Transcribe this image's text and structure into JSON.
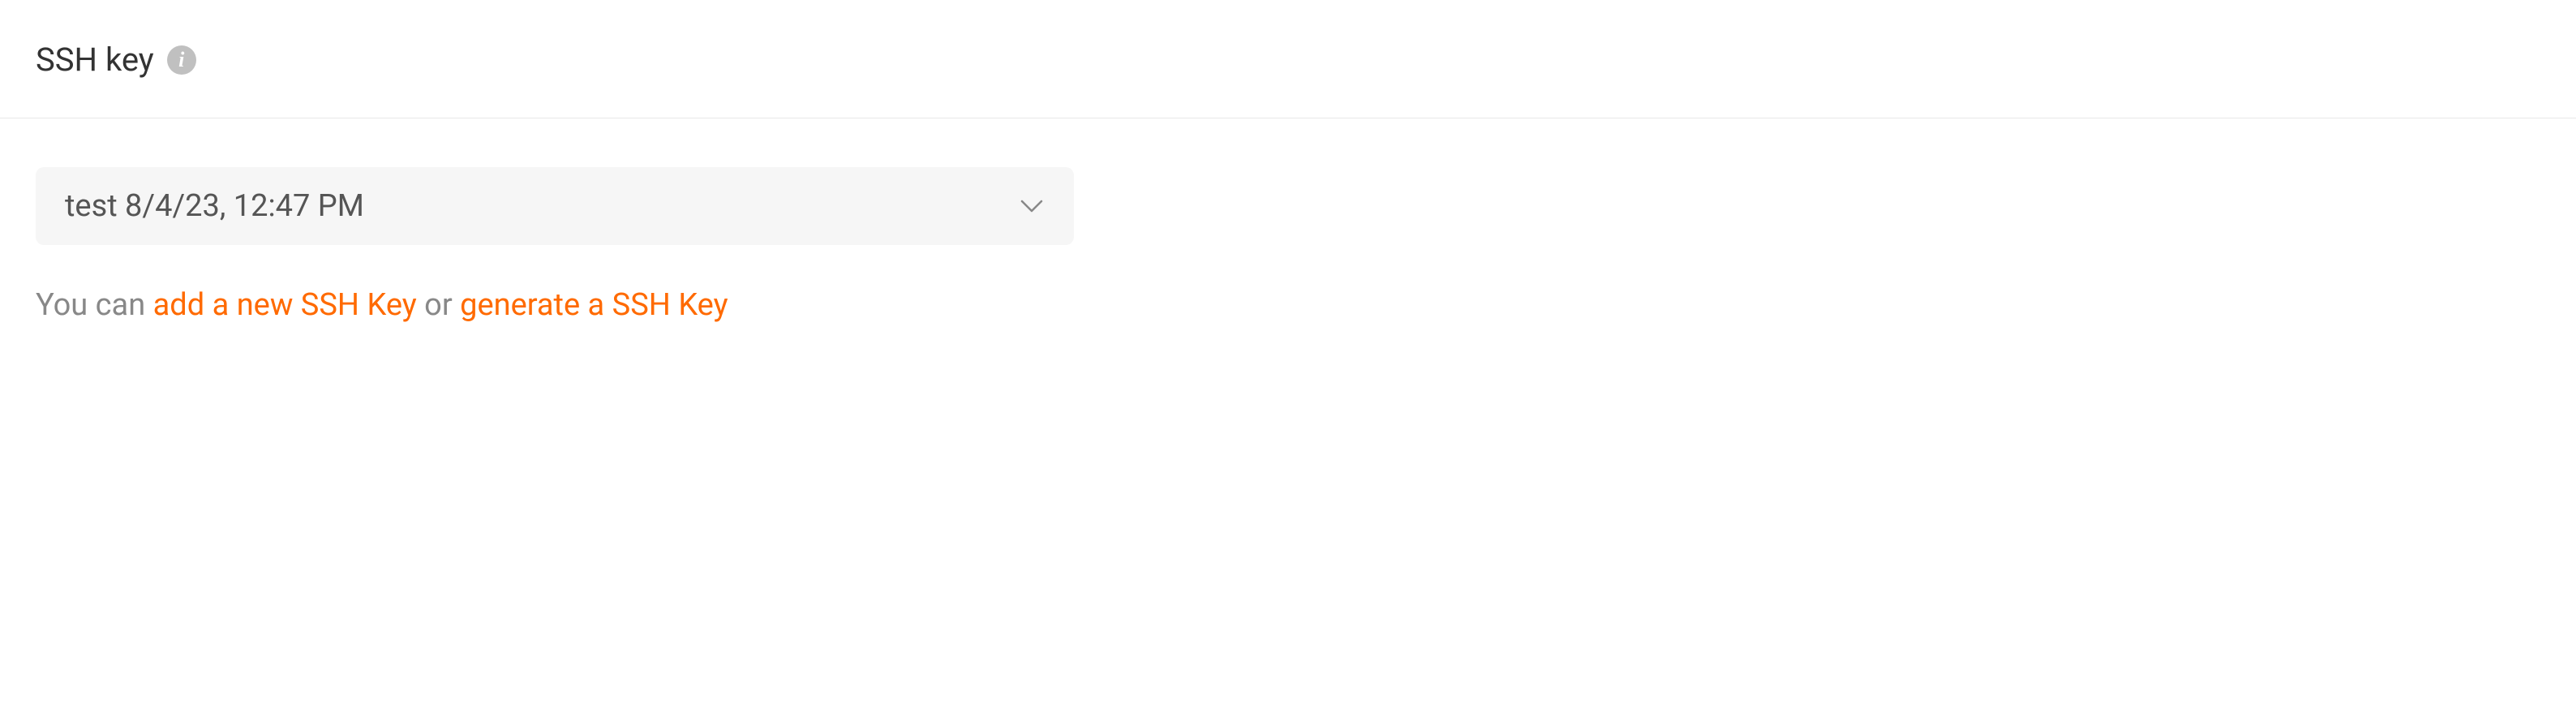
{
  "section": {
    "title": "SSH key"
  },
  "select": {
    "value": "test 8/4/23, 12:47 PM"
  },
  "helper": {
    "prefix": "You can ",
    "link_add": "add a new SSH Key",
    "middle": " or ",
    "link_generate": "generate a SSH Key"
  }
}
